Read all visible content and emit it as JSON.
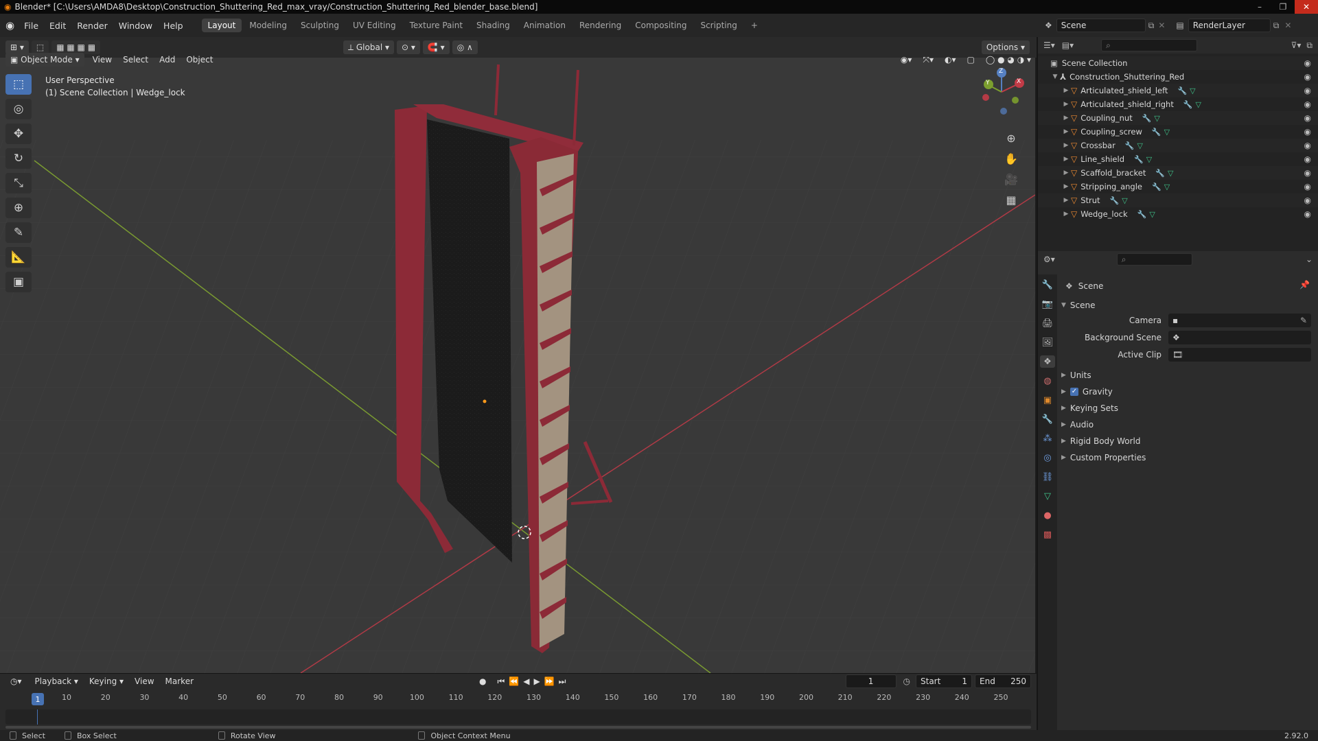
{
  "window": {
    "title": "Blender* [C:\\Users\\AMDA8\\Desktop\\Construction_Shuttering_Red_max_vray/Construction_Shuttering_Red_blender_base.blend]",
    "controls": [
      "–",
      "❐",
      "✕"
    ]
  },
  "menu": {
    "items": [
      "File",
      "Edit",
      "Render",
      "Window",
      "Help"
    ],
    "workspaces": [
      "Layout",
      "Modeling",
      "Sculpting",
      "UV Editing",
      "Texture Paint",
      "Shading",
      "Animation",
      "Rendering",
      "Compositing",
      "Scripting"
    ],
    "active_workspace": "Layout",
    "add_tab": "+"
  },
  "scene_bar": {
    "scene_name": "Scene",
    "view_layer": "RenderLayer"
  },
  "viewport_header": {
    "transform_orientation": "Global",
    "options_label": "Options",
    "mode": "Object Mode",
    "menus": [
      "View",
      "Select",
      "Add",
      "Object"
    ]
  },
  "viewport": {
    "perspective": "User Perspective",
    "context": "(1) Scene Collection | Wedge_lock",
    "gizmo_axes": {
      "x": "X",
      "y": "Y",
      "z": "Z"
    },
    "colors": {
      "background": "#393939",
      "grid": "#474747",
      "x_axis": "#b03a46",
      "y_axis": "#7a9b31",
      "panel_frame": "#8e2b3a",
      "panel_face": "#1c1c1c",
      "rail_fill": "#9f8e7c"
    }
  },
  "tools": [
    "select-box",
    "cursor",
    "move",
    "rotate",
    "scale",
    "transform",
    "annotate",
    "measure",
    "add-cube"
  ],
  "outliner": {
    "root": "Scene Collection",
    "collection": "Construction_Shuttering_Red",
    "objects": [
      "Articulated_shield_left",
      "Articulated_shield_right",
      "Coupling_nut",
      "Coupling_screw",
      "Crossbar",
      "Line_shield",
      "Scaffold_bracket",
      "Stripping_angle",
      "Strut",
      "Wedge_lock"
    ]
  },
  "properties": {
    "title": "Scene",
    "section": "Scene",
    "fields": [
      {
        "label": "Camera",
        "value": ""
      },
      {
        "label": "Background Scene",
        "value": ""
      },
      {
        "label": "Active Clip",
        "value": ""
      }
    ],
    "sections": [
      "Units",
      "Gravity",
      "Keying Sets",
      "Audio",
      "Rigid Body World",
      "Custom Properties"
    ],
    "gravity_checked": true
  },
  "timeline": {
    "menus": [
      "Playback",
      "Keying",
      "View",
      "Marker"
    ],
    "current_frame": "1",
    "start_label": "Start",
    "start": "1",
    "end_label": "End",
    "end": "250",
    "ticks": [
      "1",
      "10",
      "20",
      "30",
      "40",
      "50",
      "60",
      "70",
      "80",
      "90",
      "100",
      "110",
      "120",
      "130",
      "140",
      "150",
      "160",
      "170",
      "180",
      "190",
      "200",
      "210",
      "220",
      "230",
      "240",
      "250"
    ]
  },
  "status": {
    "items": [
      "Select",
      "Box Select",
      "Rotate View",
      "Object Context Menu"
    ],
    "version": "2.92.0"
  }
}
